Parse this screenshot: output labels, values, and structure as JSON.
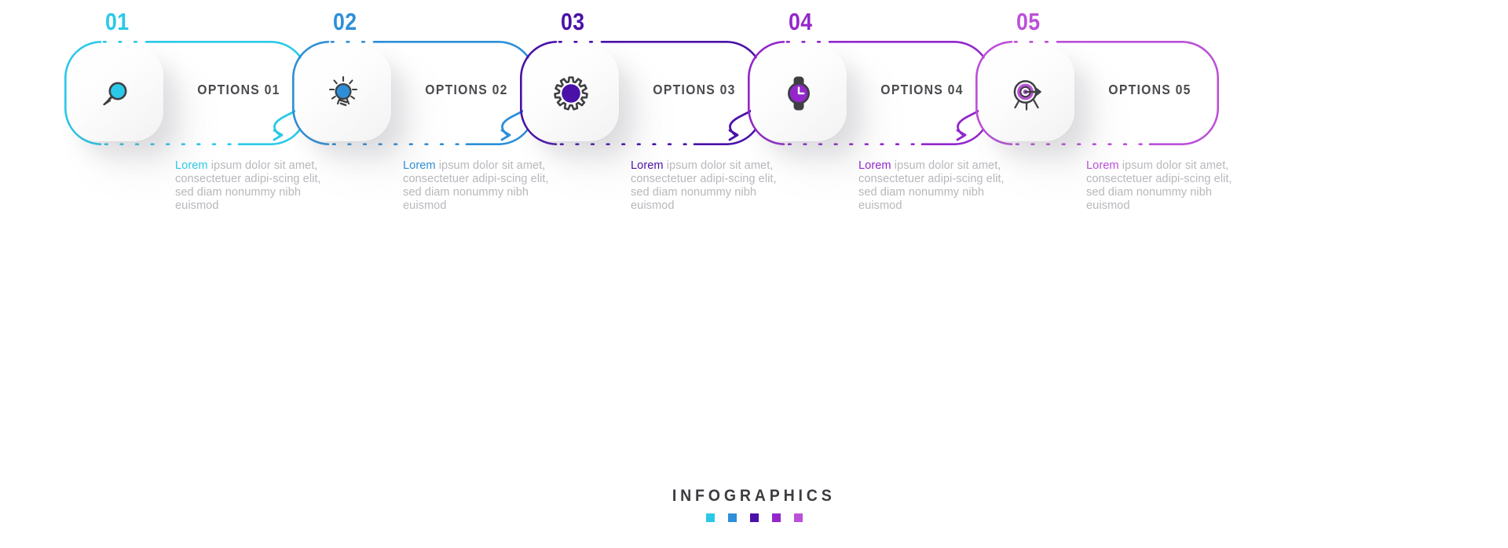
{
  "meta": {
    "background": "#ffffff",
    "body_text_color": "#b8b8bd",
    "options_label_color": "#4a4a4f"
  },
  "steps": [
    {
      "number": "01",
      "label": "OPTIONS 01",
      "icon": "magnifier-icon",
      "color": "#2BC9E8",
      "body_lead": "Lorem",
      "body_rest": " ipsum dolor sit amet, consectetuer adipi-scing elit, sed diam nonummy nibh euismod"
    },
    {
      "number": "02",
      "label": "OPTIONS 02",
      "icon": "lightbulb-icon",
      "color": "#2E8FD8",
      "body_lead": "Lorem",
      "body_rest": " ipsum dolor sit amet, consectetuer adipi-scing elit, sed diam nonummy nibh euismod"
    },
    {
      "number": "03",
      "label": "OPTIONS 03",
      "icon": "gear-icon",
      "color": "#4A11A8",
      "body_lead": "Lorem",
      "body_rest": " ipsum dolor sit amet, consectetuer adipi-scing elit, sed diam nonummy nibh euismod"
    },
    {
      "number": "04",
      "label": "OPTIONS 04",
      "icon": "wristwatch-icon",
      "color": "#9327CC",
      "body_lead": "Lorem",
      "body_rest": " ipsum dolor sit amet, consectetuer adipi-scing elit, sed diam nonummy nibh euismod"
    },
    {
      "number": "05",
      "label": "OPTIONS 05",
      "icon": "target-arrow-icon",
      "color": "#BC50D8",
      "body_lead": "Lorem",
      "body_rest": " ipsum dolor sit amet, consectetuer adipi-scing elit, sed diam nonummy nibh euismod"
    }
  ],
  "connectors": [
    {
      "from": "01",
      "to": "02",
      "color": "#2BC9E8"
    },
    {
      "from": "02",
      "to": "03",
      "color": "#2E8FD8"
    },
    {
      "from": "03",
      "to": "04",
      "color": "#4A11A8"
    },
    {
      "from": "04",
      "to": "05",
      "color": "#9327CC"
    }
  ],
  "footer": {
    "title": "INFOGRAPHICS",
    "squares": [
      "#2BC9E8",
      "#2E8FD8",
      "#4A11A8",
      "#9327CC",
      "#BC50D8"
    ]
  }
}
